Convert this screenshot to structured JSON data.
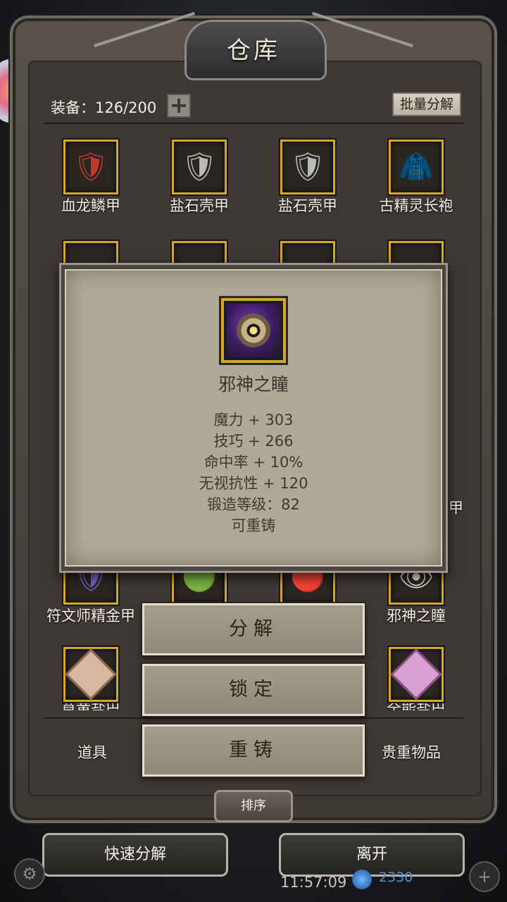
{
  "window": {
    "title": "仓库"
  },
  "header": {
    "equip_count": "装备：126/200",
    "batch_label": "批量分解"
  },
  "grid": {
    "row1": [
      {
        "name": "血龙鳞甲",
        "icon": "red-dragon-armor-icon",
        "glyph": "🛡"
      },
      {
        "name": "盐石壳甲",
        "icon": "saltstone-armor-icon",
        "glyph": "🛡"
      },
      {
        "name": "盐石壳甲",
        "icon": "saltstone-armor-icon",
        "glyph": "🛡"
      },
      {
        "name": "古精灵长袍",
        "icon": "elf-robe-icon",
        "glyph": "🧥"
      }
    ],
    "row_partial_label": "金甲",
    "row5": [
      {
        "name": "符文师精金甲",
        "icon": "runemaster-armor-icon",
        "glyph": "🛡"
      },
      {
        "name": "",
        "icon": "green-item-icon",
        "glyph": "🟢"
      },
      {
        "name": "",
        "icon": "red-item-icon",
        "glyph": "🔴"
      },
      {
        "name": "邪神之瞳",
        "icon": "evil-eye-icon",
        "glyph": "👁"
      }
    ],
    "row6_left": "草黄盐巴",
    "row6_right": "全能盐巴"
  },
  "popup": {
    "item_name": "邪神之瞳",
    "stats": [
      "魔力 + 303",
      "技巧 + 266",
      "命中率 + 10%",
      "无视抗性 + 120",
      "锻造等级：82",
      "可重铸"
    ]
  },
  "actions": {
    "decompose": "分解",
    "lock": "锁定",
    "reforge": "重铸"
  },
  "tabs": {
    "items": "道具",
    "valuables": "贵重物品"
  },
  "sort_label": "排序",
  "bottom": {
    "quick_decompose": "快速分解",
    "leave": "离开"
  },
  "status": {
    "clock": "11:57:09",
    "gems": "2330"
  },
  "colors": {
    "slot_border": "#d4a72a",
    "popup_bg": "#b1a998"
  }
}
